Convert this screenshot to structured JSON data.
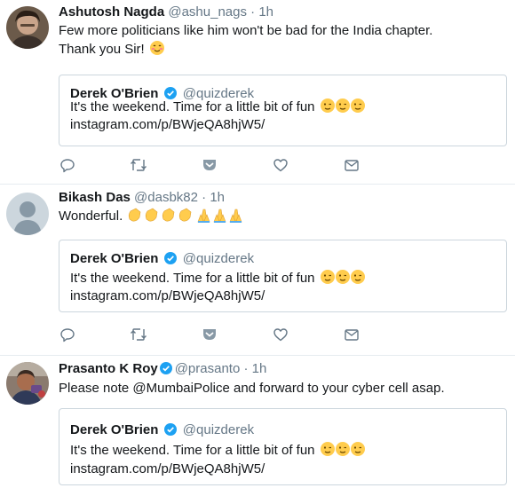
{
  "tweets": [
    {
      "name": "Ashutosh Nagda",
      "handle": "@ashu_nags",
      "separator": "·",
      "time": "1h",
      "verified": false,
      "text_lines": [
        "Few more politicians like him won't be bad for the India chapter.",
        "Thank you Sir!"
      ],
      "text_emoji": "smiling-blush-emoji"
    },
    {
      "name": "Bikash Das",
      "handle": "@dasbk82",
      "separator": "·",
      "time": "1h",
      "verified": false,
      "text_lines": [
        "Wonderful."
      ],
      "text_emoji": "clapping-hands-and-folded-hands-emoji"
    },
    {
      "name": "Prasanto K Roy",
      "handle": "@prasanto",
      "separator": "·",
      "time": "1h",
      "verified": true,
      "text_lines": [
        "Please note @MumbaiPolice and forward to your cyber cell asap."
      ],
      "text_emoji": ""
    }
  ],
  "quoted": {
    "name": "Derek O'Brien",
    "handle": "@quizderek",
    "verified": true,
    "text": "It's the weekend. Time for a little bit of fun",
    "emoji": "winking-face-emoji",
    "link": "instagram.com/p/BWjeQA8hjW5/"
  },
  "colors": {
    "accent": "#1da1f2",
    "text": "#14171a",
    "secondary": "#657786",
    "border": "#ccd6dd",
    "divider": "#e6ecf0"
  },
  "action_icons": [
    "reply-icon",
    "retweet-icon",
    "pocket-icon",
    "like-icon",
    "direct-message-icon"
  ]
}
